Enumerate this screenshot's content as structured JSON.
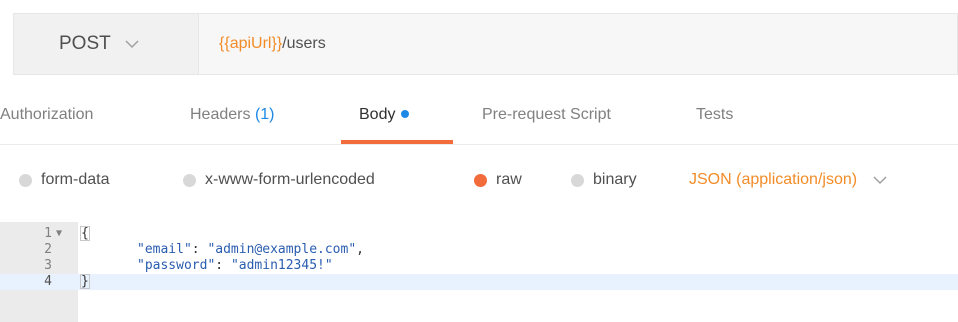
{
  "request": {
    "method": "POST",
    "url_variable": "{{apiUrl}}",
    "url_path": "/users"
  },
  "tabs": [
    {
      "label": "Authorization"
    },
    {
      "label": "Headers",
      "count": "(1)"
    },
    {
      "label": "Body",
      "active": true,
      "indicator": "dot"
    },
    {
      "label": "Pre-request Script"
    },
    {
      "label": "Tests"
    }
  ],
  "body_types": [
    {
      "label": "form-data",
      "selected": false
    },
    {
      "label": "x-www-form-urlencoded",
      "selected": false
    },
    {
      "label": "raw",
      "selected": true
    },
    {
      "label": "binary",
      "selected": false
    }
  ],
  "content_type": "JSON (application/json)",
  "editor": {
    "lines": [
      {
        "number": "1",
        "text": "{"
      },
      {
        "number": "2",
        "key": "\"email\"",
        "sep": ": ",
        "value": "\"admin@example.com\"",
        "tail": ","
      },
      {
        "number": "3",
        "key": "\"password\"",
        "sep": ": ",
        "value": "\"admin12345!\"",
        "tail": ""
      },
      {
        "number": "4",
        "text": "}"
      }
    ]
  },
  "colors": {
    "accent": "#f26b3a",
    "variable": "#f28c28",
    "count_blue": "#1e88e5"
  },
  "icons": [
    "chevron-down-icon",
    "fold-arrow-icon",
    "active-dot-icon"
  ]
}
